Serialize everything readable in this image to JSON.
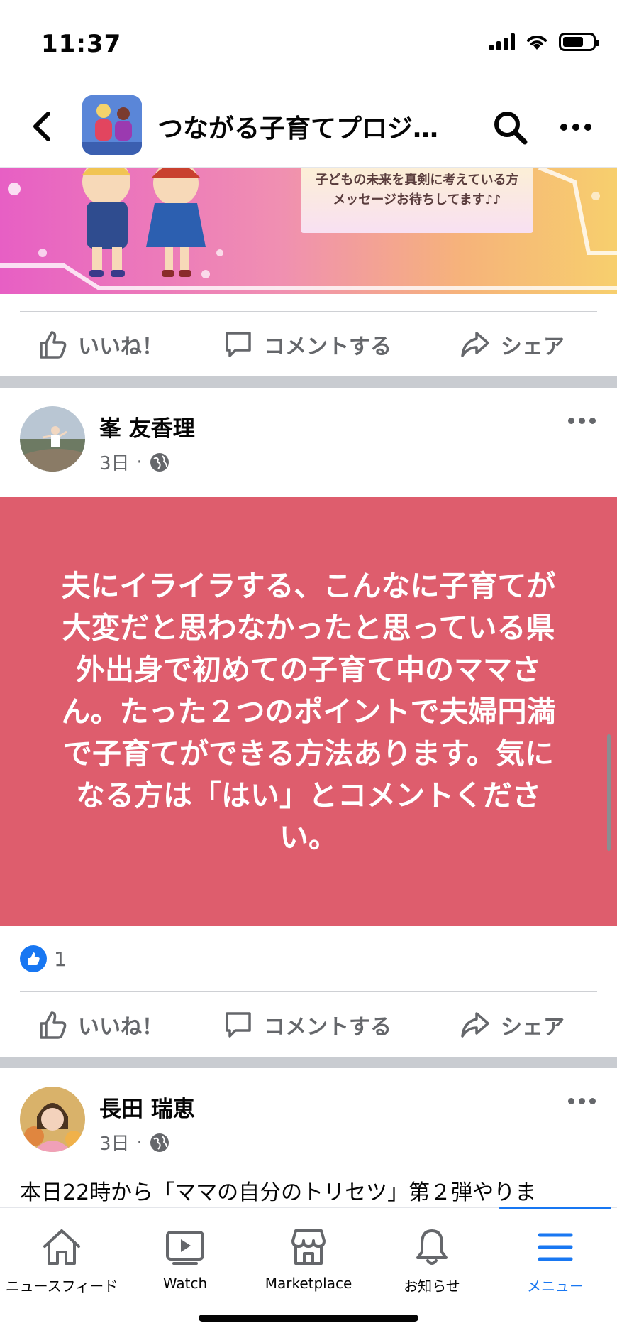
{
  "status_bar": {
    "time": "11:37"
  },
  "header": {
    "title": "つながる子育てプロジ…"
  },
  "banner": {
    "line1": "子どもの未来を真剣に考えている方",
    "line2": "メッセージお待ちしてます♪♪"
  },
  "actions": {
    "like": "いいね！",
    "comment": "コメントする",
    "share": "シェア"
  },
  "posts": [
    {
      "author": "峯 友香理",
      "time": "3日",
      "background_color": "#de5d6d",
      "text": "夫にイライラする、こんなに子育てが大変だと思わなかったと思っている県外出身で初めての子育て中のママさん。たった２つのポイントで夫婦円満で子育てができる方法あります。気になる方は「はい」とコメントください。",
      "likes": "1"
    },
    {
      "author": "長田 瑞恵",
      "time": "3日",
      "text": "本日22時から「ママの自分のトリセツ」第２弾やりま"
    }
  ],
  "bottom_nav": {
    "items": [
      {
        "label": "ニュースフィード",
        "icon": "home-icon"
      },
      {
        "label": "Watch",
        "icon": "video-icon"
      },
      {
        "label": "Marketplace",
        "icon": "shop-icon"
      },
      {
        "label": "お知らせ",
        "icon": "bell-icon"
      },
      {
        "label": "メニュー",
        "icon": "menu-icon",
        "active": true
      }
    ]
  },
  "colors": {
    "accent": "#1877f2",
    "post_bg": "#de5d6d",
    "secondary_text": "#65676b"
  }
}
